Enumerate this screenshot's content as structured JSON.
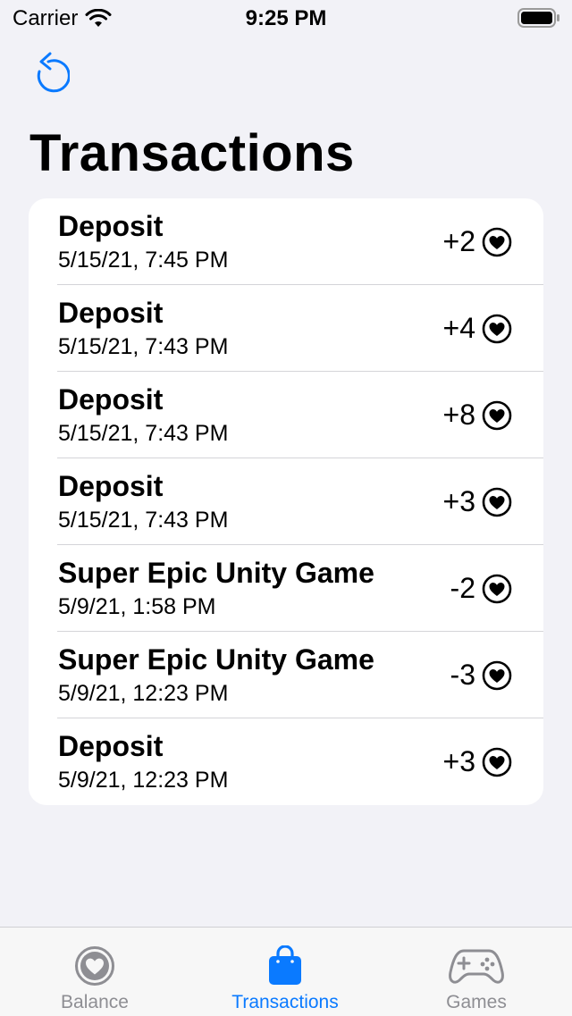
{
  "status_bar": {
    "carrier": "Carrier",
    "time": "9:25 PM"
  },
  "header": {
    "title": "Transactions",
    "refresh_icon": "refresh-icon"
  },
  "transactions": [
    {
      "title": "Deposit",
      "date": "5/15/21, 7:45 PM",
      "amount": "+2"
    },
    {
      "title": "Deposit",
      "date": "5/15/21, 7:43 PM",
      "amount": "+4"
    },
    {
      "title": "Deposit",
      "date": "5/15/21, 7:43 PM",
      "amount": "+8"
    },
    {
      "title": "Deposit",
      "date": "5/15/21, 7:43 PM",
      "amount": "+3"
    },
    {
      "title": "Super Epic Unity Game",
      "date": "5/9/21, 1:58 PM",
      "amount": "-2"
    },
    {
      "title": "Super Epic Unity Game",
      "date": "5/9/21, 12:23 PM",
      "amount": "-3"
    },
    {
      "title": "Deposit",
      "date": "5/9/21, 12:23 PM",
      "amount": "+3"
    }
  ],
  "tab_bar": {
    "tabs": [
      {
        "label": "Balance",
        "icon": "heart-circle-icon",
        "active": false
      },
      {
        "label": "Transactions",
        "icon": "shopping-bag-icon",
        "active": true
      },
      {
        "label": "Games",
        "icon": "gamecontroller-icon",
        "active": false
      }
    ]
  },
  "colors": {
    "accent": "#0a7aff",
    "inactive": "#8e8e93",
    "background": "#f2f2f7",
    "card": "#ffffff"
  }
}
